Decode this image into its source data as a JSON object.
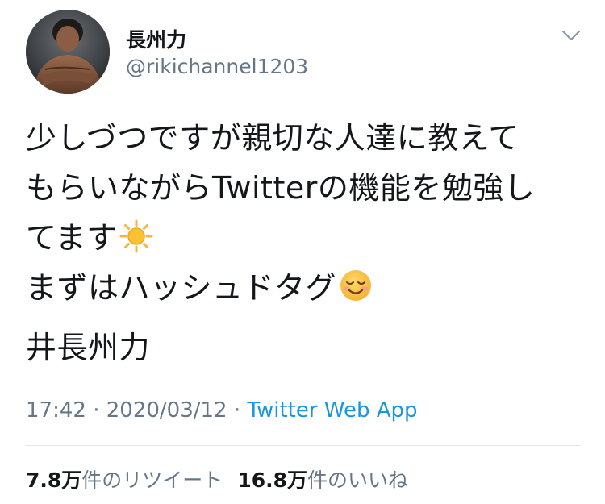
{
  "user": {
    "display_name": "長州力",
    "handle": "@rikichannel1203",
    "avatar_icon": "profile-photo"
  },
  "menu_icon": "chevron-down-icon",
  "tweet": {
    "line1": "少しづつですが親切な人達に教えて",
    "line2": "もらいながらTwitterの機能を勉強し",
    "line3": "てます",
    "line3_emoji": "sun-emoji",
    "line4": "まずはハッシュドタグ",
    "line4_emoji": "smiling-face-emoji",
    "hashtag": "井長州力"
  },
  "meta": {
    "time": "17:42",
    "separator1": " · ",
    "date": "2020/03/12",
    "separator2": " · ",
    "source": "Twitter Web App"
  },
  "stats": {
    "retweets_count": "7.8万",
    "retweets_label": "件のリツイート",
    "likes_count": "16.8万",
    "likes_label": "件のいいね"
  },
  "colors": {
    "text": "#14171a",
    "secondary": "#657786",
    "link": "#1b95e0",
    "divider": "#e1e8ed"
  }
}
